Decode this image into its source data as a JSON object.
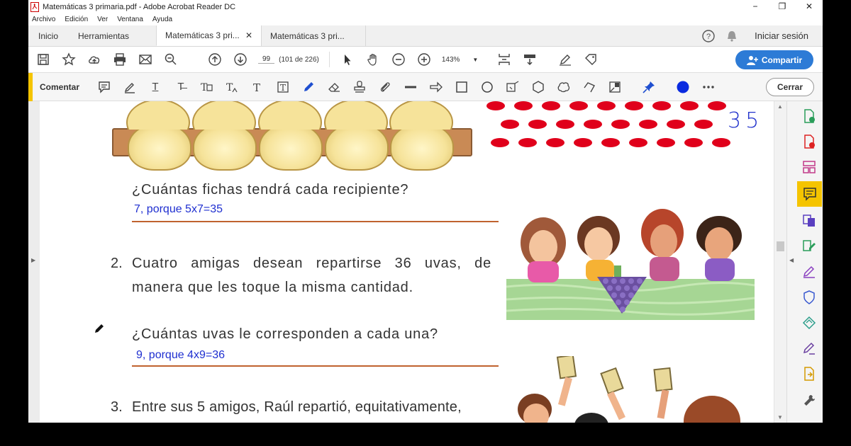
{
  "window": {
    "title": "Matemáticas 3 primaria.pdf - Adobe Acrobat Reader DC",
    "controls": [
      "−",
      "❐",
      "✕"
    ]
  },
  "menu": [
    "Archivo",
    "Edición",
    "Ver",
    "Ventana",
    "Ayuda"
  ],
  "tabs": {
    "home": "Inicio",
    "tools": "Herramientas",
    "docs": [
      {
        "label": "Matemáticas 3 pri...",
        "active": true
      },
      {
        "label": "Matemáticas 3 pri...",
        "active": false
      }
    ],
    "help_icon": "help-icon",
    "bell_icon": "bell-icon",
    "sign_in": "Iniciar sesión"
  },
  "toolbar": {
    "page_number": "99",
    "page_info": "(101 de 226)",
    "zoom": "143%",
    "share_label": "Compartir"
  },
  "commentbar": {
    "label": "Comentar",
    "close_label": "Cerrar",
    "accent_color": "#f5c400",
    "ink_color": "#0a2be0"
  },
  "document": {
    "handwritten_total": "35",
    "q1": "¿Cuántas fichas tendrá cada recipiente?",
    "a1": "7, porque 5x7=35",
    "item2_number": "2.",
    "item2_text": "Cuatro amigas desean repartirse 36 uvas, de manera que les toque la misma cantidad.",
    "q2": "¿Cuántas uvas le corresponden a cada una?",
    "a2": "9, porque 4x9=36",
    "item3_number": "3.",
    "item3_text": "Entre sus 5 amigos, Raúl repartió, equitativamente,"
  },
  "colors": {
    "share_button": "#2d7bd6",
    "answer_text": "#1f2fd0",
    "answer_line": "#c0622e",
    "chip_red": "#e0001b"
  }
}
